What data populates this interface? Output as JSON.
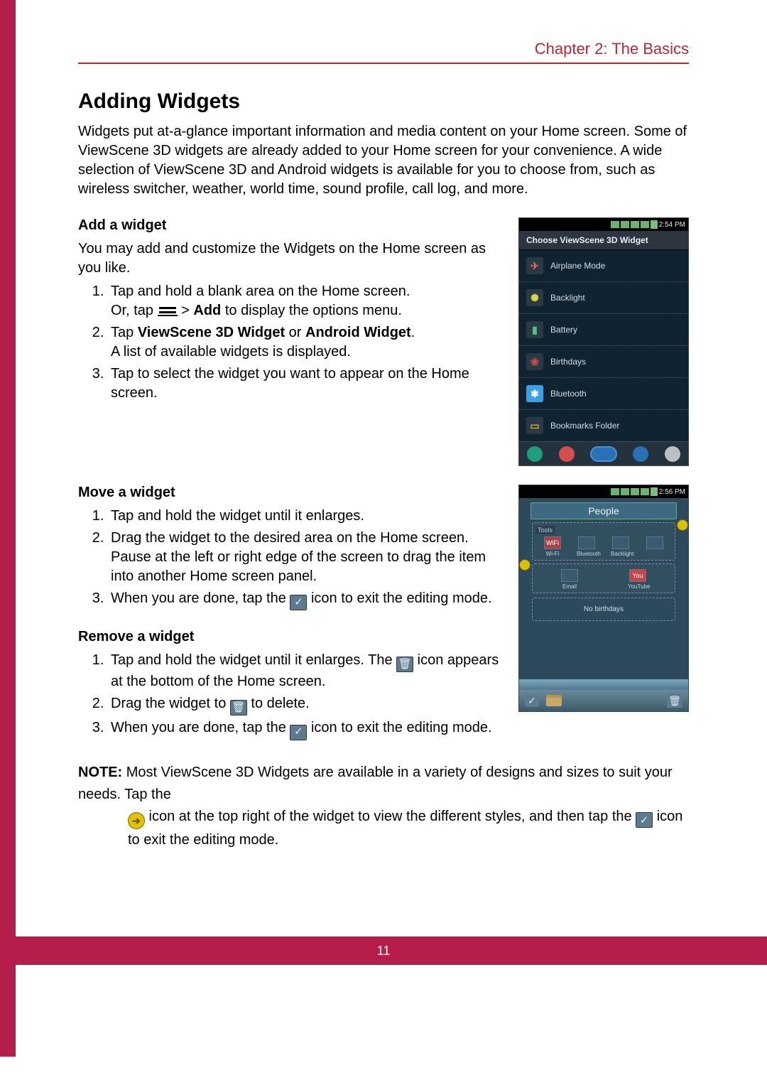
{
  "chapter": "Chapter 2: The Basics",
  "h1": "Adding Widgets",
  "intro": "Widgets put at-a-glance important information and media content on your Home screen. Some of ViewScene 3D widgets are already added to your Home screen for your convenience. A wide selection of ViewScene 3D and Android widgets is available for you to choose from, such as wireless switcher, weather, world time, sound profile, call log, and more.",
  "add": {
    "head": "Add a widget",
    "desc": "You may add and customize the Widgets on the Home screen as you like.",
    "s1": "Tap and hold a blank area on the Home screen.",
    "s1b_a": "Or, tap ",
    "s1b_b": " > ",
    "s1b_add": "Add",
    "s1b_c": " to display the options menu.",
    "s2_a": "Tap ",
    "s2_b": "ViewScene 3D Widget",
    "s2_c": " or ",
    "s2_d": "Android Widget",
    "s2_e": ".",
    "s2f": "A list of available widgets is displayed.",
    "s3": "Tap to select the widget you want to appear on the Home screen."
  },
  "move": {
    "head": "Move a widget",
    "s1": "Tap and hold the widget until it enlarges.",
    "s2a": "Drag the widget to the desired area on the Home screen.",
    "s2b": "Pause at the left or right edge of the screen to drag the item into another Home screen panel.",
    "s3a": "When you are done, tap the ",
    "s3b": " icon to exit the editing mode."
  },
  "remove": {
    "head": "Remove a widget",
    "s1a": "Tap and hold the widget until it enlarges. The ",
    "s1b": " icon appears at the bottom of the Home screen.",
    "s2a": "Drag the widget to ",
    "s2b": " to delete.",
    "s3a": "When you are done, tap the ",
    "s3b": " icon to exit the editing mode."
  },
  "note": {
    "label": "NOTE:",
    "a": " Most ViewScene 3D Widgets are available in a variety of designs and sizes to suit your needs. Tap the ",
    "b": " icon at the top right of the widget to view the different styles, and then  tap the ",
    "c": " icon to exit the editing mode."
  },
  "fig1": {
    "time": "2:54 PM",
    "title": "Choose ViewScene 3D Widget",
    "rows": [
      {
        "label": "Airplane Mode",
        "bg": "#2a3a44",
        "fg": "#e06060",
        "glyph": "✈"
      },
      {
        "label": "Backlight",
        "bg": "#2a3a44",
        "fg": "#e6d24a",
        "glyph": "✺"
      },
      {
        "label": "Battery",
        "bg": "#2a3a44",
        "fg": "#58bf8a",
        "glyph": "▮"
      },
      {
        "label": "Birthdays",
        "bg": "#2a3a44",
        "fg": "#d84a4a",
        "glyph": "❀"
      },
      {
        "label": "Bluetooth",
        "bg": "#3aa0e8",
        "fg": "#ffffff",
        "glyph": "✱"
      },
      {
        "label": "Bookmarks Folder",
        "bg": "#2a3a44",
        "fg": "#c8a850",
        "glyph": "▭"
      }
    ]
  },
  "fig2": {
    "time": "2:56 PM",
    "people": "People",
    "panel1_head": "Tools",
    "tiles1": [
      {
        "label": "Wi-Fi",
        "cls": "wifi",
        "glyph": "WiFi"
      },
      {
        "label": "Bluetooth",
        "cls": "",
        "glyph": ""
      },
      {
        "label": "Backlight",
        "cls": "",
        "glyph": ""
      },
      {
        "label": "",
        "cls": "",
        "glyph": ""
      }
    ],
    "tiles2": [
      {
        "label": "Email",
        "cls": "",
        "glyph": ""
      },
      {
        "label": "YouTube",
        "cls": "yt",
        "glyph": "You"
      }
    ],
    "nobirth": "No birthdays"
  },
  "page_number": "11"
}
